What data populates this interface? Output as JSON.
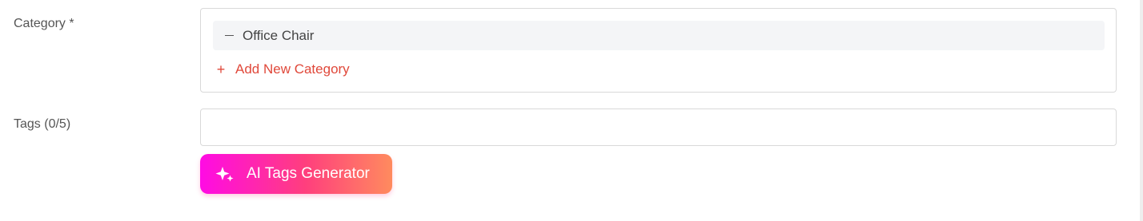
{
  "category": {
    "label": "Category *",
    "items": [
      {
        "name": "Office Chair",
        "remove_icon": "minus-icon"
      }
    ],
    "add_label": "Add New Category",
    "add_icon": "plus-icon"
  },
  "tags": {
    "label": "Tags (0/5)",
    "value": "",
    "placeholder": ""
  },
  "ai_button": {
    "label": "AI Tags Generator",
    "icon": "sparkle-icon"
  },
  "colors": {
    "accent_red": "#e0483a",
    "gradient_start": "#ff0be4",
    "gradient_end": "#ff8b5e"
  }
}
